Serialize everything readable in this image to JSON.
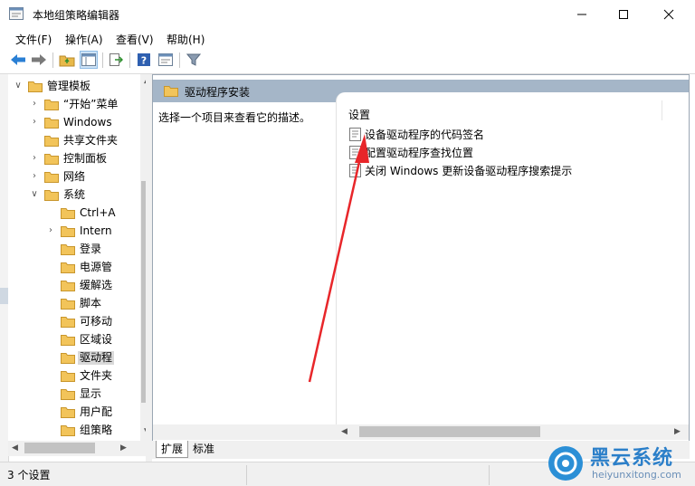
{
  "window": {
    "title": "本地组策略编辑器"
  },
  "menu": [
    "文件(F)",
    "操作(A)",
    "查看(V)",
    "帮助(H)"
  ],
  "tree": [
    {
      "label": "管理模板",
      "expander": "v",
      "selected": false
    },
    {
      "label": "“开始”菜单",
      "expander": ">",
      "selected": false
    },
    {
      "label": "Windows",
      "expander": ">",
      "selected": false
    },
    {
      "label": "共享文件夹",
      "expander": "",
      "selected": false
    },
    {
      "label": "控制面板",
      "expander": ">",
      "selected": false
    },
    {
      "label": "网络",
      "expander": ">",
      "selected": false
    },
    {
      "label": "系统",
      "expander": "v",
      "selected": false
    },
    {
      "label": "Ctrl+A",
      "expander": "",
      "selected": false
    },
    {
      "label": "Intern",
      "expander": ">",
      "selected": false
    },
    {
      "label": "登录",
      "expander": "",
      "selected": false
    },
    {
      "label": "电源管",
      "expander": "",
      "selected": false
    },
    {
      "label": "缓解选",
      "expander": "",
      "selected": false
    },
    {
      "label": "脚本",
      "expander": "",
      "selected": false
    },
    {
      "label": "可移动",
      "expander": "",
      "selected": false
    },
    {
      "label": "区域设",
      "expander": "",
      "selected": false
    },
    {
      "label": "驱动程",
      "expander": "",
      "selected": true
    },
    {
      "label": "文件夹",
      "expander": "",
      "selected": false
    },
    {
      "label": "显示",
      "expander": "",
      "selected": false
    },
    {
      "label": "用户配",
      "expander": "",
      "selected": false
    },
    {
      "label": "组策略",
      "expander": "",
      "selected": false
    }
  ],
  "content": {
    "header_title": "驱动程序安装",
    "description": "选择一个项目来查看它的描述。",
    "column_header": "设置",
    "settings": [
      "设备驱动程序的代码签名",
      "配置驱动程序查找位置",
      "关闭 Windows 更新设备驱动程序搜索提示"
    ]
  },
  "tabs": [
    "扩展",
    "标准"
  ],
  "status": {
    "text": "3 个设置"
  },
  "watermark": {
    "title": "黑云系统",
    "url": "heiyunxitong.com"
  },
  "colors": {
    "header_bg": "#a5b6c8",
    "arrow": "#e8262a",
    "folder": "#f2c45a",
    "watermark": "#2b8fd6"
  }
}
